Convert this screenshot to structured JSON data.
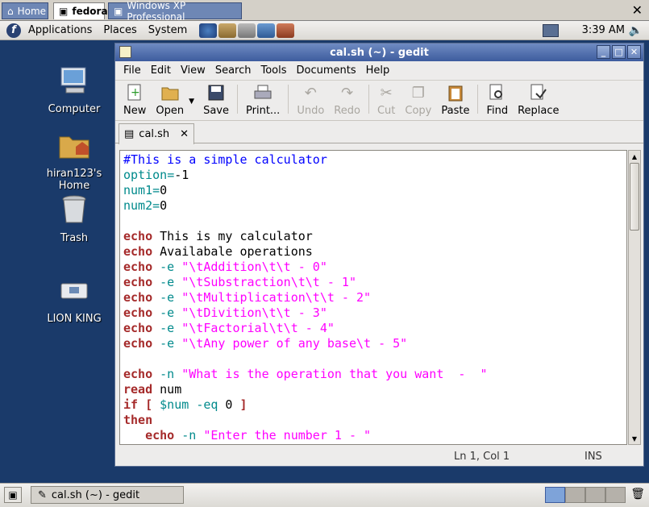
{
  "vm": {
    "tabs": [
      {
        "label": "Home"
      },
      {
        "label": "fedora"
      },
      {
        "label": "Windows XP Professional"
      }
    ],
    "close_label": "✕"
  },
  "top_panel": {
    "menus": [
      "Applications",
      "Places",
      "System"
    ],
    "clock": "3:39 AM"
  },
  "desktop": {
    "icons": [
      {
        "label": "Computer"
      },
      {
        "label": "hiran123's Home"
      },
      {
        "label": "Trash"
      },
      {
        "label": "LION KING"
      }
    ]
  },
  "gedit": {
    "title": "cal.sh (~) - gedit",
    "menus": [
      "File",
      "Edit",
      "View",
      "Search",
      "Tools",
      "Documents",
      "Help"
    ],
    "toolbar": {
      "new": "New",
      "open": "Open",
      "save": "Save",
      "print": "Print...",
      "undo": "Undo",
      "redo": "Redo",
      "cut": "Cut",
      "copy": "Copy",
      "paste": "Paste",
      "find": "Find",
      "replace": "Replace"
    },
    "tab_label": "cal.sh",
    "status": {
      "position": "Ln 1, Col 1",
      "mode": "INS"
    }
  },
  "code": {
    "comment": "#This is a simple calculator",
    "l2_var": "option",
    "l2_val": "-1",
    "l3_var": "num1",
    "l3_val": "0",
    "l4_var": "num2",
    "l4_val": "0",
    "echo": "echo",
    "l6_text": " This is my calculator",
    "l7_text": " Availabale operations",
    "opt_e": "-e",
    "opt_n": "-n",
    "s1": "\"\\tAddition\\t\\t - 0\"",
    "s2": "\"\\tSubstraction\\t\\t - 1\"",
    "s3": "\"\\tMultiplication\\t\\t - 2\"",
    "s4": "\"\\tDivition\\t\\t - 3\"",
    "s5": "\"\\tFactorial\\t\\t - 4\"",
    "s6": "\"\\tAny power of any base\\t - 5\"",
    "s7": "\"What is the operation that you want  -  \"",
    "read": "read",
    "read_arg": " num",
    "if": "if [",
    "if_var": "$num",
    "if_op": "-eq",
    "if_val": " 0 ",
    "if_close": "]",
    "then": "then",
    "s8": "\"Enter the number 1 - \""
  },
  "bottom_panel": {
    "task": "cal.sh (~) - gedit"
  }
}
